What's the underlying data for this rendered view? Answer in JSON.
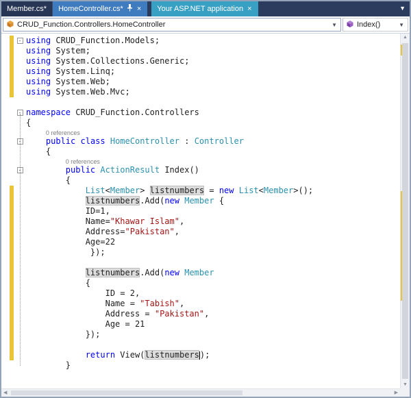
{
  "tabs": {
    "member": "Member.cs*",
    "home": "HomeController.cs*",
    "app": "Your ASP.NET application",
    "close_glyph": "×",
    "overflow_glyph": "▼"
  },
  "navbar": {
    "class_path": "CRUD_Function.Controllers.HomeController",
    "method": "Index()",
    "caret_glyph": "▼"
  },
  "colors": {
    "active_tab": "#3f7cbf",
    "preview_tab": "#38a0c3",
    "tab_strip": "#2b3c5f",
    "keyword": "#0000ff",
    "type": "#2b91af",
    "string": "#a31515",
    "change_bar": "#eac437",
    "reference_highlight": "#dcdcdc"
  },
  "scrollbar": {
    "up_glyph": "▲",
    "down_glyph": "▼",
    "left_glyph": "◀",
    "right_glyph": "▶"
  },
  "code": {
    "lines": [
      {
        "fold": true,
        "bar": true,
        "seg": [
          [
            "k",
            "using"
          ],
          [
            "p",
            " CRUD_Function.Models;"
          ]
        ]
      },
      {
        "bar": true,
        "seg": [
          [
            "k",
            "using"
          ],
          [
            "p",
            " System;"
          ]
        ]
      },
      {
        "bar": true,
        "seg": [
          [
            "k",
            "using"
          ],
          [
            "p",
            " System.Collections.Generic;"
          ]
        ]
      },
      {
        "bar": true,
        "seg": [
          [
            "k",
            "using"
          ],
          [
            "p",
            " System.Linq;"
          ]
        ]
      },
      {
        "bar": true,
        "seg": [
          [
            "k",
            "using"
          ],
          [
            "p",
            " System.Web;"
          ]
        ]
      },
      {
        "bar": true,
        "seg": [
          [
            "k",
            "using"
          ],
          [
            "p",
            " System.Web.Mvc;"
          ]
        ]
      },
      {
        "seg": []
      },
      {
        "fold": true,
        "seg": [
          [
            "k",
            "namespace"
          ],
          [
            "p",
            " CRUD_Function.Controllers"
          ]
        ]
      },
      {
        "seg": [
          [
            "p",
            "{"
          ]
        ]
      },
      {
        "lens": true,
        "seg": [
          [
            "sp",
            "    "
          ],
          [
            "lens",
            "0 references"
          ]
        ]
      },
      {
        "fold": true,
        "seg": [
          [
            "p",
            "    "
          ],
          [
            "k",
            "public"
          ],
          [
            "p",
            " "
          ],
          [
            "k",
            "class"
          ],
          [
            "p",
            " "
          ],
          [
            "t",
            "HomeController"
          ],
          [
            "p",
            " : "
          ],
          [
            "t",
            "Controller"
          ]
        ]
      },
      {
        "seg": [
          [
            "p",
            "    {"
          ]
        ]
      },
      {
        "lens": true,
        "seg": [
          [
            "sp",
            "        "
          ],
          [
            "lens",
            "0 references"
          ]
        ]
      },
      {
        "fold": true,
        "seg": [
          [
            "p",
            "        "
          ],
          [
            "k",
            "public"
          ],
          [
            "p",
            " "
          ],
          [
            "t",
            "ActionResult"
          ],
          [
            "p",
            " Index()"
          ]
        ]
      },
      {
        "seg": [
          [
            "p",
            "        {"
          ]
        ]
      },
      {
        "bar": true,
        "seg": [
          [
            "p",
            "            "
          ],
          [
            "t",
            "List"
          ],
          [
            "p",
            "<"
          ],
          [
            "t",
            "Member"
          ],
          [
            "p",
            "> "
          ],
          [
            "h",
            "listnumbers"
          ],
          [
            "p",
            " = "
          ],
          [
            "k",
            "new"
          ],
          [
            "p",
            " "
          ],
          [
            "t",
            "List"
          ],
          [
            "p",
            "<"
          ],
          [
            "t",
            "Member"
          ],
          [
            "p",
            ">();"
          ]
        ]
      },
      {
        "bar": true,
        "seg": [
          [
            "p",
            "            "
          ],
          [
            "h",
            "listnumbers"
          ],
          [
            "p",
            ".Add("
          ],
          [
            "k",
            "new"
          ],
          [
            "p",
            " "
          ],
          [
            "t",
            "Member"
          ],
          [
            "p",
            " {"
          ]
        ]
      },
      {
        "bar": true,
        "seg": [
          [
            "p",
            "            ID=1,"
          ]
        ]
      },
      {
        "bar": true,
        "seg": [
          [
            "p",
            "            Name="
          ],
          [
            "s",
            "\"Khawar Islam\""
          ],
          [
            "p",
            ","
          ]
        ]
      },
      {
        "bar": true,
        "seg": [
          [
            "p",
            "            Address="
          ],
          [
            "s",
            "\"Pakistan\""
          ],
          [
            "p",
            ","
          ]
        ]
      },
      {
        "bar": true,
        "seg": [
          [
            "p",
            "            Age=22"
          ]
        ]
      },
      {
        "bar": true,
        "seg": [
          [
            "p",
            "             });"
          ]
        ]
      },
      {
        "bar": true,
        "seg": []
      },
      {
        "bar": true,
        "seg": [
          [
            "p",
            "            "
          ],
          [
            "h",
            "listnumbers"
          ],
          [
            "p",
            ".Add("
          ],
          [
            "k",
            "new"
          ],
          [
            "p",
            " "
          ],
          [
            "t",
            "Member"
          ]
        ]
      },
      {
        "bar": true,
        "seg": [
          [
            "p",
            "            {"
          ]
        ]
      },
      {
        "bar": true,
        "seg": [
          [
            "p",
            "                ID = 2,"
          ]
        ]
      },
      {
        "bar": true,
        "seg": [
          [
            "p",
            "                Name = "
          ],
          [
            "s",
            "\"Tabish\""
          ],
          [
            "p",
            ","
          ]
        ]
      },
      {
        "bar": true,
        "seg": [
          [
            "p",
            "                Address = "
          ],
          [
            "s",
            "\"Pakistan\""
          ],
          [
            "p",
            ","
          ]
        ]
      },
      {
        "bar": true,
        "seg": [
          [
            "p",
            "                Age = 21"
          ]
        ]
      },
      {
        "bar": true,
        "seg": [
          [
            "p",
            "            });"
          ]
        ]
      },
      {
        "bar": true,
        "seg": []
      },
      {
        "bar": true,
        "seg": [
          [
            "p",
            "            "
          ],
          [
            "k",
            "return"
          ],
          [
            "p",
            " View("
          ],
          [
            "hc",
            "listnumbers"
          ],
          [
            "p",
            ");"
          ]
        ]
      },
      {
        "seg": [
          [
            "p",
            "        }"
          ]
        ]
      }
    ]
  }
}
